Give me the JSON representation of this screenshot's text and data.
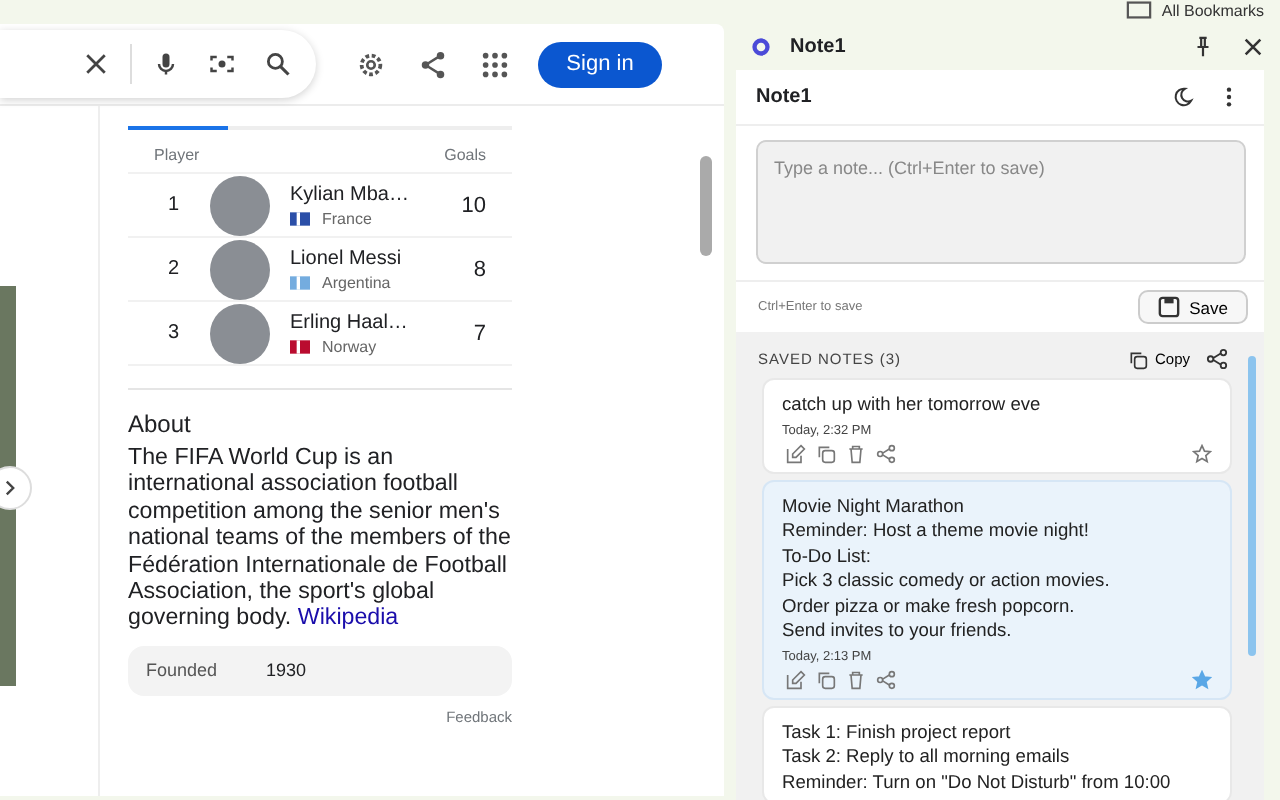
{
  "bookmarks": {
    "label": "All Bookmarks"
  },
  "header": {
    "sign_in": "Sign in"
  },
  "leaderboard": {
    "columns": [
      "Player",
      "Goals"
    ],
    "rows": [
      {
        "rank": "1",
        "name": "Kylian Mba…",
        "country": "France",
        "goals": "10",
        "color": "#2b4fa8"
      },
      {
        "rank": "2",
        "name": "Lionel Messi",
        "country": "Argentina",
        "goals": "8",
        "color": "#74acdf"
      },
      {
        "rank": "3",
        "name": "Erling Haal…",
        "country": "Norway",
        "goals": "7",
        "color": "#ba0c2f"
      }
    ]
  },
  "about": {
    "title": "About",
    "text": "The FIFA World Cup is an international association football competition among the senior men's national teams of the members of the Fédération Internationale de Football Association, the sport's global governing body.",
    "link": "Wikipedia",
    "facts": [
      {
        "label": "Founded",
        "value": "1930"
      }
    ],
    "feedback": "Feedback"
  },
  "note_panel": {
    "title": "Note1",
    "editor_title": "Note1",
    "placeholder": "Type a note... (Ctrl+Enter to save)",
    "hint": "Ctrl+Enter to save",
    "save": "Save",
    "saved_header": "SAVED NOTES (3)",
    "copy": "Copy",
    "notes": [
      {
        "lines": [
          "catch up with her tomorrow eve"
        ],
        "time": "Today, 2:32 PM",
        "starred": false,
        "selected": false
      },
      {
        "lines": [
          "Movie Night Marathon",
          "Reminder: Host a theme movie night!",
          "To-Do List:",
          "Pick 3 classic comedy or action movies.",
          "Order pizza or make fresh popcorn.",
          "Send invites to your friends."
        ],
        "time": "Today, 2:13 PM",
        "starred": true,
        "selected": true
      },
      {
        "lines": [
          "Task 1: Finish project report",
          "Task 2: Reply to all morning emails",
          "Reminder: Turn on \"Do Not Disturb\" from 10:00"
        ],
        "selected": false
      }
    ]
  }
}
